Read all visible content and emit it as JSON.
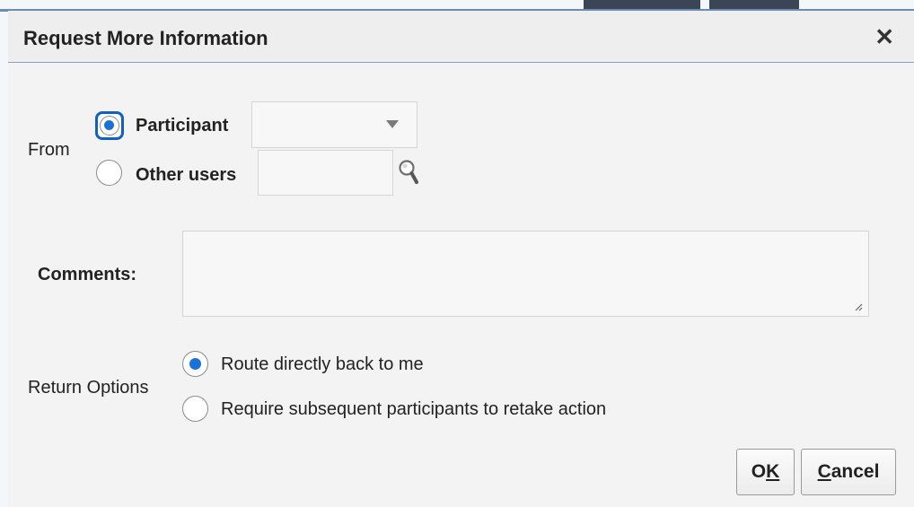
{
  "dialog": {
    "title": "Request More Information",
    "close_glyph": "✕"
  },
  "from": {
    "label": "From",
    "options": [
      {
        "label": "Participant",
        "selected": true
      },
      {
        "label": "Other users",
        "selected": false
      }
    ],
    "participant_value": "",
    "other_users_value": ""
  },
  "comments": {
    "label": "Comments:",
    "value": ""
  },
  "return_options": {
    "label": "Return Options",
    "options": [
      {
        "label": "Route directly back to me",
        "selected": true
      },
      {
        "label": "Require subsequent participants to retake action",
        "selected": false
      }
    ]
  },
  "buttons": {
    "ok": {
      "prefix": "O",
      "access_key": "K",
      "suffix": ""
    },
    "cancel": {
      "prefix": "",
      "access_key": "C",
      "suffix": "ancel"
    }
  },
  "colors": {
    "accent": "#1a72d6",
    "focus_ring": "#1161c5",
    "header_rule": "#8aa0bb"
  },
  "icons": {
    "close": "close-icon",
    "dropdown": "chevron-down-icon",
    "search": "search-icon",
    "resize": "resize-grip-icon"
  }
}
